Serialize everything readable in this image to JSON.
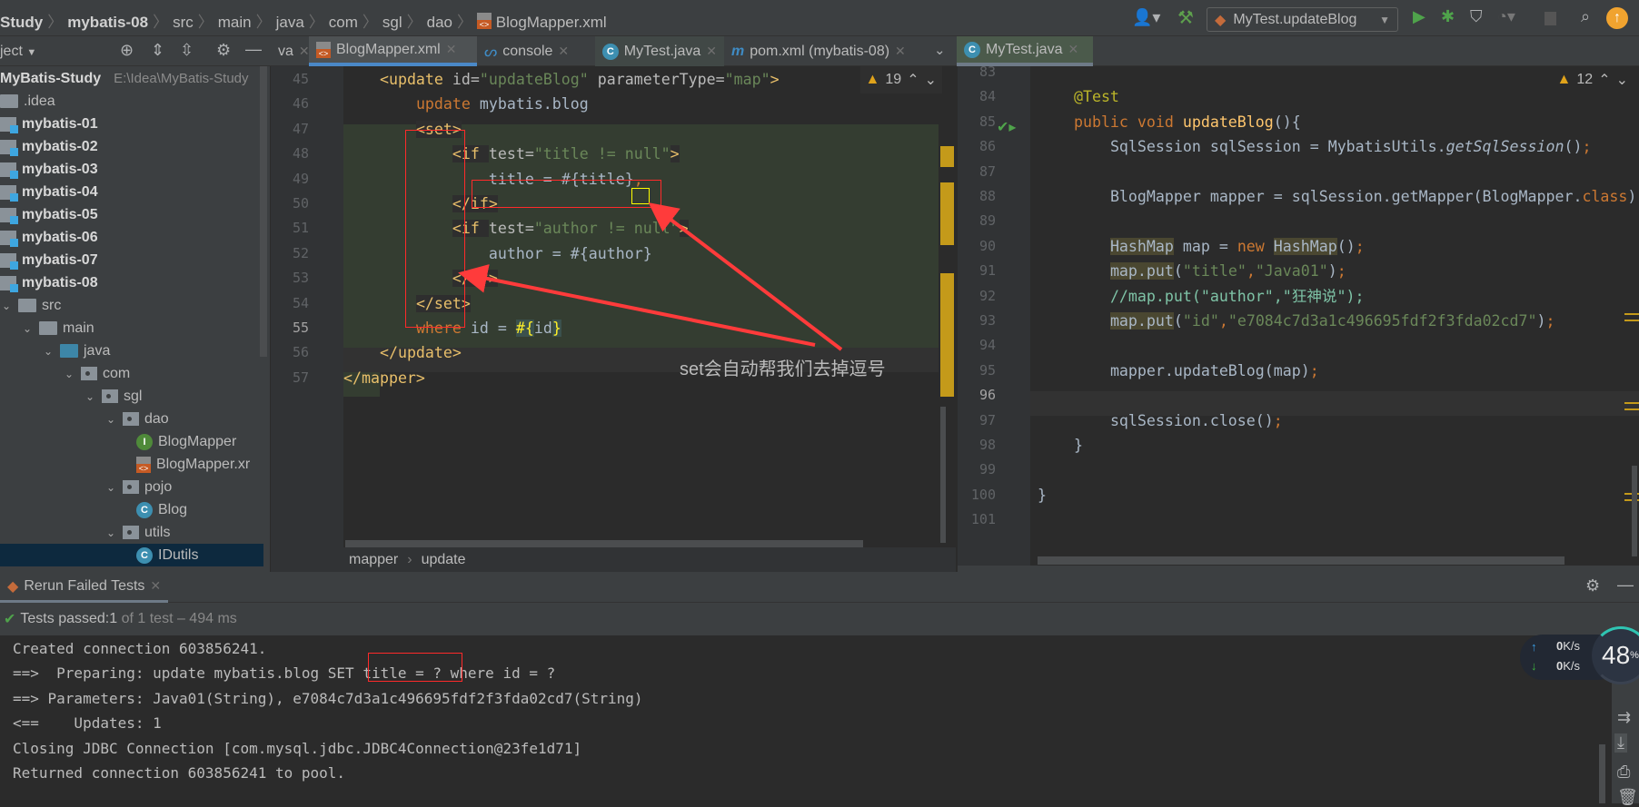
{
  "breadcrumb": [
    "Study",
    "mybatis-08",
    "src",
    "main",
    "java",
    "com",
    "sgl",
    "dao",
    "BlogMapper.xml"
  ],
  "toolbar": {
    "run_config": "MyTest.updateBlog"
  },
  "project_panel": {
    "title": "ject",
    "root_name": "MyBatis-Study",
    "root_path": "E:\\Idea\\MyBatis-Study"
  },
  "tree": [
    {
      "label": ".idea",
      "level": 0,
      "icon": "folder",
      "bold": false
    },
    {
      "label": "mybatis-01",
      "level": 0,
      "icon": "module",
      "bold": true
    },
    {
      "label": "mybatis-02",
      "level": 0,
      "icon": "module",
      "bold": true
    },
    {
      "label": "mybatis-03",
      "level": 0,
      "icon": "module",
      "bold": true
    },
    {
      "label": "mybatis-04",
      "level": 0,
      "icon": "module",
      "bold": true
    },
    {
      "label": "mybatis-05",
      "level": 0,
      "icon": "module",
      "bold": true
    },
    {
      "label": "mybatis-06",
      "level": 0,
      "icon": "module",
      "bold": true
    },
    {
      "label": "mybatis-07",
      "level": 0,
      "icon": "module",
      "bold": true
    },
    {
      "label": "mybatis-08",
      "level": 0,
      "icon": "module",
      "bold": true
    },
    {
      "label": "src",
      "level": 0,
      "icon": "folder",
      "expanded": true
    },
    {
      "label": "main",
      "level": 1,
      "icon": "folder",
      "expanded": true
    },
    {
      "label": "java",
      "level": 2,
      "icon": "source-folder",
      "expanded": true
    },
    {
      "label": "com",
      "level": 3,
      "icon": "package",
      "expanded": true
    },
    {
      "label": "sgl",
      "level": 4,
      "icon": "package",
      "expanded": true
    },
    {
      "label": "dao",
      "level": 5,
      "icon": "package",
      "expanded": true
    },
    {
      "label": "BlogMapper",
      "level": 6,
      "icon": "interface"
    },
    {
      "label": "BlogMapper.xr",
      "level": 6,
      "icon": "xml-file"
    },
    {
      "label": "pojo",
      "level": 5,
      "icon": "package",
      "expanded": true
    },
    {
      "label": "Blog",
      "level": 6,
      "icon": "class"
    },
    {
      "label": "utils",
      "level": 5,
      "icon": "package",
      "expanded": true
    },
    {
      "label": "IDutils",
      "level": 6,
      "icon": "class",
      "selected": true
    }
  ],
  "tabs_left": [
    {
      "label": "va",
      "partial": true
    },
    {
      "label": "BlogMapper.xml",
      "icon": "xml-file",
      "active": true
    },
    {
      "label": "console",
      "icon": "mysql-console"
    },
    {
      "label": "MyTest.java",
      "icon": "class"
    },
    {
      "label": "pom.xml (mybatis-08)",
      "icon": "maven"
    }
  ],
  "tabs_right": [
    {
      "label": "MyTest.java",
      "icon": "class",
      "active": true
    }
  ],
  "left_editor": {
    "warnings": "19",
    "current_line": 55,
    "lines": [
      {
        "n": 45,
        "tokens": [
          [
            "    ",
            "txt"
          ],
          [
            "<update ",
            "tag"
          ],
          [
            "id=",
            "attr"
          ],
          [
            "\"updateBlog\" ",
            "str"
          ],
          [
            "parameterType=",
            "attr"
          ],
          [
            "\"map\"",
            "str"
          ],
          [
            ">",
            "tag"
          ]
        ]
      },
      {
        "n": 46,
        "tokens": [
          [
            "        ",
            "txt"
          ],
          [
            "update ",
            "kw"
          ],
          [
            "mybatis.blog",
            "txt"
          ]
        ]
      },
      {
        "n": 47,
        "tokens": [
          [
            "        ",
            "txt"
          ],
          [
            "<set>",
            "tag"
          ]
        ]
      },
      {
        "n": 48,
        "tokens": [
          [
            "            ",
            "txt"
          ],
          [
            "<if ",
            "tag"
          ],
          [
            "test=",
            "attr"
          ],
          [
            "\"title != null\"",
            "str"
          ],
          [
            ">",
            "tag"
          ]
        ]
      },
      {
        "n": 49,
        "tokens": [
          [
            "                ",
            "txt"
          ],
          [
            "title = #{title}",
            "txt"
          ],
          [
            ",",
            "kw"
          ]
        ]
      },
      {
        "n": 50,
        "tokens": [
          [
            "            ",
            "txt"
          ],
          [
            "</if>",
            "tag"
          ]
        ]
      },
      {
        "n": 51,
        "tokens": [
          [
            "            ",
            "txt"
          ],
          [
            "<if ",
            "tag"
          ],
          [
            "test=",
            "attr"
          ],
          [
            "\"author != null\"",
            "str"
          ],
          [
            ">",
            "tag"
          ]
        ]
      },
      {
        "n": 52,
        "tokens": [
          [
            "                ",
            "txt"
          ],
          [
            "author = #{author}",
            "txt"
          ]
        ]
      },
      {
        "n": 53,
        "tokens": [
          [
            "            ",
            "txt"
          ],
          [
            "</if>",
            "tag"
          ]
        ]
      },
      {
        "n": 54,
        "tokens": [
          [
            "        ",
            "txt"
          ],
          [
            "</set>",
            "tag"
          ]
        ]
      },
      {
        "n": 55,
        "tokens": [
          [
            "        ",
            "txt"
          ],
          [
            "where ",
            "kw"
          ],
          [
            "id = ",
            "txt"
          ],
          [
            "#{",
            "brace"
          ],
          [
            "id",
            "txt"
          ],
          [
            "}",
            "brace"
          ]
        ]
      },
      {
        "n": 56,
        "tokens": [
          [
            "    ",
            "txt"
          ],
          [
            "</update>",
            "tag"
          ]
        ]
      },
      {
        "n": 57,
        "tokens": [
          [
            "</mapper>",
            "tag"
          ]
        ]
      }
    ],
    "breadcrumb": [
      "mapper",
      "update"
    ]
  },
  "annotation": {
    "text": "set会自动帮我们去掉逗号",
    "color": "#ff2a2a"
  },
  "right_editor": {
    "warnings": "12",
    "current_line": 96,
    "lines": [
      {
        "n": 83,
        "tokens": []
      },
      {
        "n": 84,
        "tokens": [
          [
            "    ",
            "txt"
          ],
          [
            "@Test",
            "ann"
          ]
        ]
      },
      {
        "n": 85,
        "tokens": [
          [
            "    ",
            "txt"
          ],
          [
            "public void ",
            "kw"
          ],
          [
            "updateBlog",
            "fn"
          ],
          [
            "(){",
            "txt"
          ]
        ]
      },
      {
        "n": 86,
        "tokens": [
          [
            "        ",
            "txt"
          ],
          [
            "SqlSession sqlSession = MybatisUtils.",
            "txt"
          ],
          [
            "getSqlSession",
            "it"
          ],
          [
            "()",
            "txt"
          ],
          [
            ";",
            "kw"
          ]
        ]
      },
      {
        "n": 87,
        "tokens": []
      },
      {
        "n": 88,
        "tokens": [
          [
            "        ",
            "txt"
          ],
          [
            "BlogMapper mapper = sqlSession.getMapper(BlogMapper.",
            "txt"
          ],
          [
            "class",
            "kw"
          ],
          [
            ")",
            "txt"
          ]
        ]
      },
      {
        "n": 89,
        "tokens": []
      },
      {
        "n": 90,
        "tokens": [
          [
            "        ",
            "txt"
          ],
          [
            "HashMap",
            "hl"
          ],
          [
            " map = ",
            "txt"
          ],
          [
            "new ",
            "kw"
          ],
          [
            "HashMap",
            "hl"
          ],
          [
            "()",
            "txt"
          ],
          [
            ";",
            "kw"
          ]
        ]
      },
      {
        "n": 91,
        "tokens": [
          [
            "        ",
            "txt"
          ],
          [
            "map.put",
            "hl"
          ],
          [
            "(",
            "txt"
          ],
          [
            "\"title\"",
            "str"
          ],
          [
            ",",
            "kw"
          ],
          [
            "\"Java01\"",
            "str"
          ],
          [
            ")",
            "txt"
          ],
          [
            ";",
            "kw"
          ]
        ]
      },
      {
        "n": 92,
        "tokens": [
          [
            "        ",
            "txt"
          ],
          [
            "//map.put(\"author\",\"狂神说\");",
            "cmt"
          ]
        ]
      },
      {
        "n": 93,
        "tokens": [
          [
            "        ",
            "txt"
          ],
          [
            "map.put",
            "hl"
          ],
          [
            "(",
            "txt"
          ],
          [
            "\"id\"",
            "str"
          ],
          [
            ",",
            "kw"
          ],
          [
            "\"e7084c7d3a1c496695fdf2f3fda02cd7\"",
            "str"
          ],
          [
            ")",
            "txt"
          ],
          [
            ";",
            "kw"
          ]
        ]
      },
      {
        "n": 94,
        "tokens": []
      },
      {
        "n": 95,
        "tokens": [
          [
            "        ",
            "txt"
          ],
          [
            "mapper.updateBlog(map)",
            "txt"
          ],
          [
            ";",
            "kw"
          ]
        ]
      },
      {
        "n": 96,
        "tokens": []
      },
      {
        "n": 97,
        "tokens": [
          [
            "        ",
            "txt"
          ],
          [
            "sqlSession.close()",
            "txt"
          ],
          [
            ";",
            "kw"
          ]
        ]
      },
      {
        "n": 98,
        "tokens": [
          [
            "    ",
            "txt"
          ],
          [
            "}",
            "txt"
          ]
        ]
      },
      {
        "n": 99,
        "tokens": []
      },
      {
        "n": 100,
        "tokens": [
          [
            "}",
            "txt"
          ]
        ]
      },
      {
        "n": 101,
        "tokens": []
      }
    ]
  },
  "run_panel": {
    "tab_label": "Rerun Failed Tests",
    "status_prefix": "Tests passed: ",
    "status_count": "1",
    "status_suffix": " of 1 test – 494 ms",
    "console": [
      "Created connection 603856241.",
      "==>  Preparing: update mybatis.blog SET title = ? where id = ?",
      "==> Parameters: Java01(String), e7084c7d3a1c496695fdf2f3fda02cd7(String)",
      "<==    Updates: 1",
      "Closing JDBC Connection [com.mysql.jdbc.JDBC4Connection@23fe1d71]",
      "Returned connection 603856241 to pool."
    ]
  },
  "net_widget": {
    "upload": "0",
    "download": "0",
    "unit": "K/s",
    "cpu_percent": "48",
    "percent_sign": "%"
  }
}
